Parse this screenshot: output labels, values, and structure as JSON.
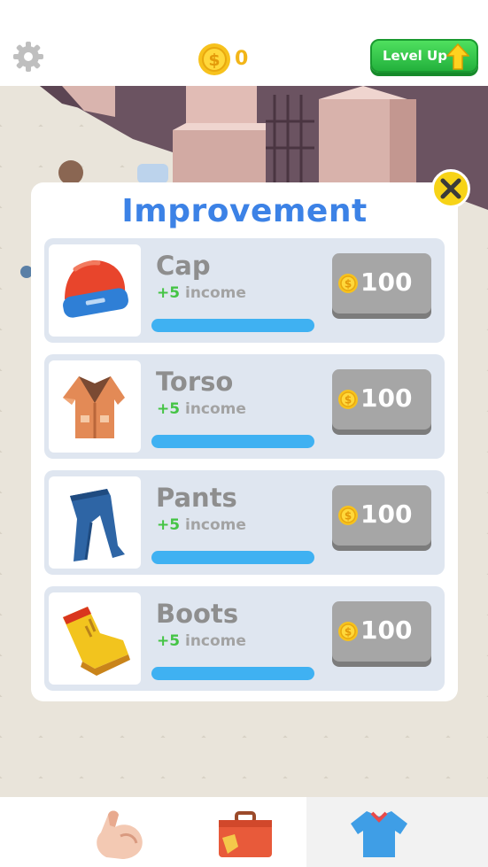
{
  "hud": {
    "coins": "0",
    "level_up_label": "Level Up",
    "icons": [
      "gear-icon",
      "coin-icon",
      "up-arrow-icon"
    ]
  },
  "panel": {
    "title": "Improvement",
    "close_icon": "close-icon",
    "items": [
      {
        "name": "Cap",
        "bonus": "+5",
        "bonus_text": "income",
        "price": "100",
        "icon": "cap-icon"
      },
      {
        "name": "Torso",
        "bonus": "+5",
        "bonus_text": "income",
        "price": "100",
        "icon": "jacket-icon"
      },
      {
        "name": "Pants",
        "bonus": "+5",
        "bonus_text": "income",
        "price": "100",
        "icon": "pants-icon"
      },
      {
        "name": "Boots",
        "bonus": "+5",
        "bonus_text": "income",
        "price": "100",
        "icon": "boot-icon"
      }
    ]
  },
  "bottom_nav": {
    "tabs": [
      {
        "icon": "muscle-arm-icon",
        "active": false
      },
      {
        "icon": "suitcase-icon",
        "active": false
      },
      {
        "icon": "shirt-icon",
        "active": true
      }
    ]
  },
  "colors": {
    "title_blue": "#3c82e6",
    "bar_blue": "#3fb1f2",
    "bonus_green": "#45c445",
    "coin_gold": "#f2b518",
    "level_green": "#23b13c"
  }
}
